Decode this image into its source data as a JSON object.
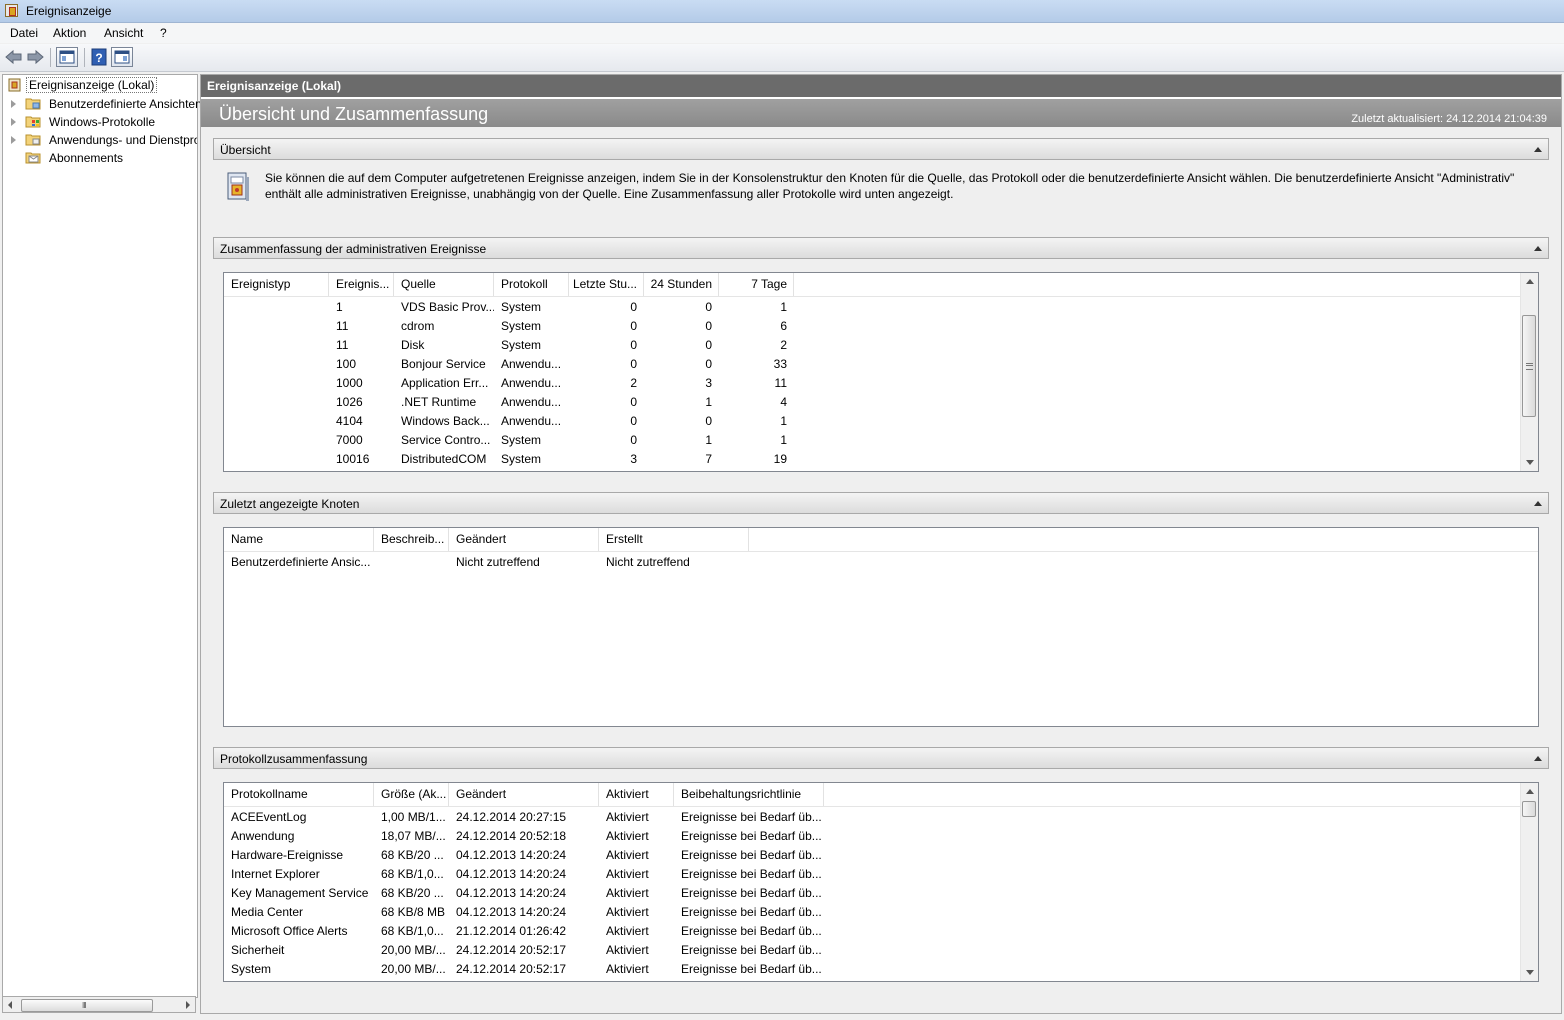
{
  "window": {
    "title": "Ereignisanzeige"
  },
  "menu": [
    "Datei",
    "Aktion",
    "Ansicht",
    "?"
  ],
  "tree": {
    "root": "Ereignisanzeige (Lokal)",
    "items": [
      {
        "label": "Benutzerdefinierte Ansichten",
        "icon": "folder-custom-views-icon"
      },
      {
        "label": "Windows-Protokolle",
        "icon": "folder-windows-logs-icon"
      },
      {
        "label": "Anwendungs- und Dienstprotokolle",
        "icon": "folder-app-logs-icon"
      },
      {
        "label": "Abonnements",
        "icon": "subscriptions-icon"
      }
    ]
  },
  "pane": {
    "header": "Ereignisanzeige (Lokal)",
    "title": "Übersicht und Zusammenfassung",
    "last_updated": "Zuletzt aktualisiert: 24.12.2014 21:04:39"
  },
  "overview": {
    "header": "Übersicht",
    "text": "Sie können die auf dem Computer aufgetretenen Ereignisse anzeigen, indem Sie in der Konsolenstruktur den Knoten für die Quelle, das Protokoll oder die benutzerdefinierte Ansicht wählen. Die benutzerdefinierte Ansicht \"Administrativ\" enthält alle administrativen Ereignisse, unabhängig von der Quelle. Eine Zusammenfassung aller Protokolle wird unten angezeigt."
  },
  "admin_summary": {
    "header": "Zusammenfassung der administrativen Ereignisse",
    "columns": [
      "Ereignistyp",
      "Ereignis...",
      "Quelle",
      "Protokoll",
      "Letzte Stu...",
      "24 Stunden",
      "7 Tage"
    ],
    "rows": [
      [
        "",
        "1",
        "VDS Basic Prov...",
        "System",
        "0",
        "0",
        "1"
      ],
      [
        "",
        "11",
        "cdrom",
        "System",
        "0",
        "0",
        "6"
      ],
      [
        "",
        "11",
        "Disk",
        "System",
        "0",
        "0",
        "2"
      ],
      [
        "",
        "100",
        "Bonjour Service",
        "Anwendu...",
        "0",
        "0",
        "33"
      ],
      [
        "",
        "1000",
        "Application Err...",
        "Anwendu...",
        "2",
        "3",
        "11"
      ],
      [
        "",
        "1026",
        ".NET Runtime",
        "Anwendu...",
        "0",
        "1",
        "4"
      ],
      [
        "",
        "4104",
        "Windows Back...",
        "Anwendu...",
        "0",
        "0",
        "1"
      ],
      [
        "",
        "7000",
        "Service Contro...",
        "System",
        "0",
        "1",
        "1"
      ],
      [
        "",
        "10016",
        "DistributedCOM",
        "System",
        "3",
        "7",
        "19"
      ]
    ]
  },
  "recent_nodes": {
    "header": "Zuletzt angezeigte Knoten",
    "columns": [
      "Name",
      "Beschreib...",
      "Geändert",
      "Erstellt"
    ],
    "rows": [
      [
        "Benutzerdefinierte Ansic...",
        "",
        "Nicht zutreffend",
        "Nicht zutreffend"
      ]
    ]
  },
  "log_summary": {
    "header": "Protokollzusammenfassung",
    "columns": [
      "Protokollname",
      "Größe (Ak...",
      "Geändert",
      "Aktiviert",
      "Beibehaltungsrichtlinie"
    ],
    "rows": [
      [
        "ACEEventLog",
        "1,00 MB/1...",
        "24.12.2014 20:27:15",
        "Aktiviert",
        "Ereignisse bei Bedarf üb..."
      ],
      [
        "Anwendung",
        "18,07 MB/...",
        "24.12.2014 20:52:18",
        "Aktiviert",
        "Ereignisse bei Bedarf üb..."
      ],
      [
        "Hardware-Ereignisse",
        "68 KB/20 ...",
        "04.12.2013 14:20:24",
        "Aktiviert",
        "Ereignisse bei Bedarf üb..."
      ],
      [
        "Internet Explorer",
        "68 KB/1,0...",
        "04.12.2013 14:20:24",
        "Aktiviert",
        "Ereignisse bei Bedarf üb..."
      ],
      [
        "Key Management Service",
        "68 KB/20 ...",
        "04.12.2013 14:20:24",
        "Aktiviert",
        "Ereignisse bei Bedarf üb..."
      ],
      [
        "Media Center",
        "68 KB/8 MB",
        "04.12.2013 14:20:24",
        "Aktiviert",
        "Ereignisse bei Bedarf üb..."
      ],
      [
        "Microsoft Office Alerts",
        "68 KB/1,0...",
        "21.12.2014 01:26:42",
        "Aktiviert",
        "Ereignisse bei Bedarf üb..."
      ],
      [
        "Sicherheit",
        "20,00 MB/...",
        "24.12.2014 20:52:17",
        "Aktiviert",
        "Ereignisse bei Bedarf üb..."
      ],
      [
        "System",
        "20,00 MB/...",
        "24.12.2014 20:52:17",
        "Aktiviert",
        "Ereignisse bei Bedarf üb..."
      ]
    ]
  },
  "colors": {
    "pane_header": "#6b6b6b",
    "overview_header": "#8a8a8a",
    "content_bg": "#efefef"
  }
}
